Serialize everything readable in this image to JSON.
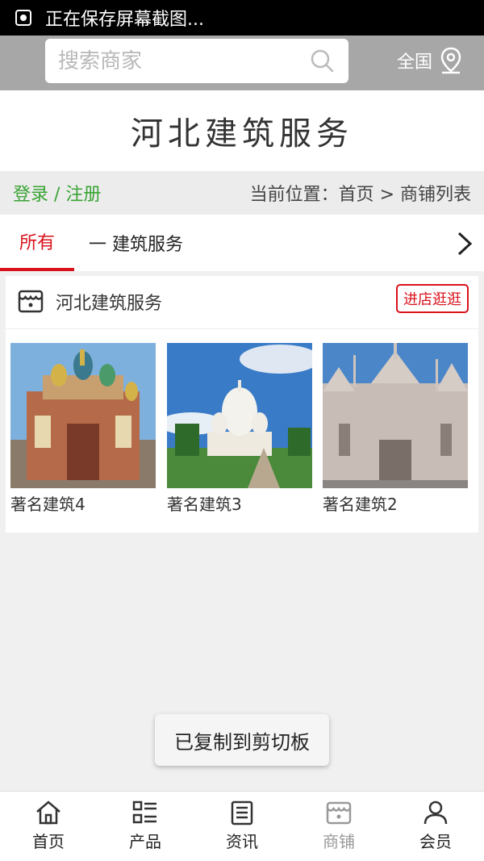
{
  "status_bar": {
    "text": "正在保存屏幕截图..."
  },
  "search": {
    "placeholder": "搜索商家",
    "region_label": "全国"
  },
  "brand": {
    "title": "河北建筑服务"
  },
  "breadcrumb_bar": {
    "login_label": "登录 / 注册",
    "path_text": "当前位置：首页 > 商铺列表"
  },
  "tabs": {
    "all_label": "所有",
    "category_label": "一 建筑服务"
  },
  "shop": {
    "name": "河北建筑服务",
    "visit_label": "进店逛逛",
    "products": [
      {
        "name": "著名建筑4"
      },
      {
        "name": "著名建筑3"
      },
      {
        "name": "著名建筑2"
      }
    ]
  },
  "toast": {
    "text": "已复制到剪切板"
  },
  "bottom_nav": {
    "items": [
      {
        "label": "首页",
        "icon": "home-icon"
      },
      {
        "label": "产品",
        "icon": "list-icon"
      },
      {
        "label": "资讯",
        "icon": "news-icon"
      },
      {
        "label": "商铺",
        "icon": "store-icon",
        "active": true
      },
      {
        "label": "会员",
        "icon": "user-icon"
      }
    ]
  },
  "colors": {
    "accent_red": "#d8121b",
    "login_green": "#3aa435",
    "search_bar_bg": "#a7a7a7"
  }
}
